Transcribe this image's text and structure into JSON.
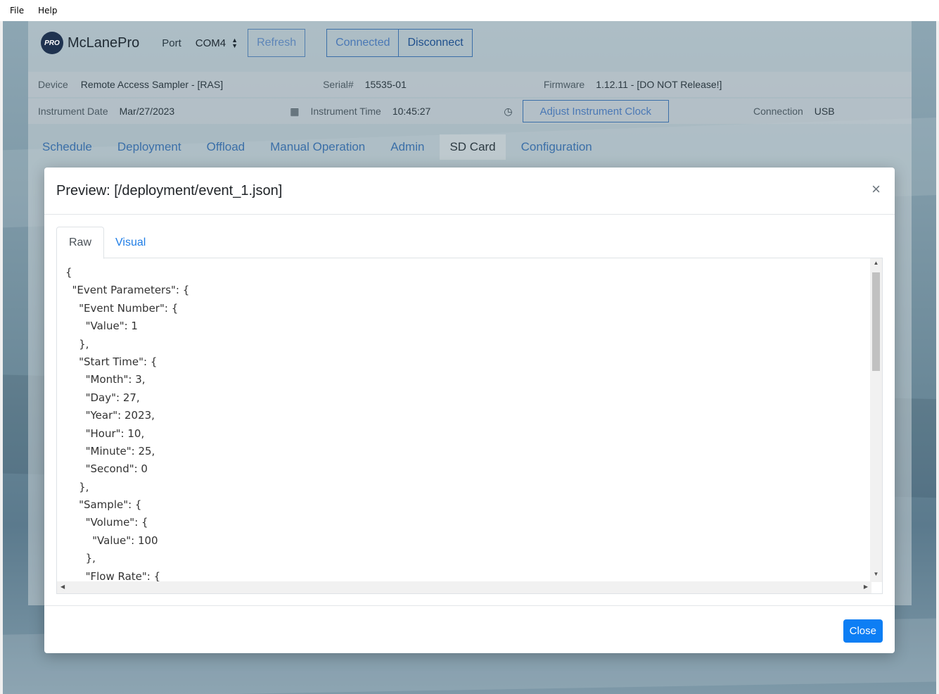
{
  "menu": {
    "file": "File",
    "help": "Help"
  },
  "app": {
    "logo_mark": "PRO",
    "brand": "McLanePro",
    "port_label": "Port",
    "port_value": "COM4",
    "refresh": "Refresh",
    "connected": "Connected",
    "disconnect": "Disconnect",
    "device_label": "Device",
    "device_value": "Remote Access Sampler - [RAS]",
    "serial_label": "Serial#",
    "serial_value": "15535-01",
    "firmware_label": "Firmware",
    "firmware_value": "1.12.11 - [DO NOT Release!]",
    "date_label": "Instrument Date",
    "date_value": "Mar/27/2023",
    "time_label": "Instrument Time",
    "time_value": "10:45:27",
    "adjust_clock": "Adjust Instrument Clock",
    "connection_label": "Connection",
    "connection_value": "USB",
    "tabs": [
      "Schedule",
      "Deployment",
      "Offload",
      "Manual Operation",
      "Admin",
      "SD Card",
      "Configuration"
    ]
  },
  "modal": {
    "title": "Preview: [/deployment/event_1.json]",
    "close_x": "×",
    "tab_raw": "Raw",
    "tab_visual": "Visual",
    "close_button": "Close",
    "code_lines": [
      "{",
      "  \"Event Parameters\": {",
      "    \"Event Number\": {",
      "      \"Value\": 1",
      "    },",
      "    \"Start Time\": {",
      "      \"Month\": 3,",
      "      \"Day\": 27,",
      "      \"Year\": 2023,",
      "      \"Hour\": 10,",
      "      \"Minute\": 25,",
      "      \"Second\": 0",
      "    },",
      "    \"Sample\": {",
      "      \"Volume\": {",
      "        \"Value\": 100",
      "      },",
      "      \"Flow Rate\": {"
    ]
  },
  "colors": {
    "accent": "#0d7ef4",
    "link": "#1f7de6"
  }
}
